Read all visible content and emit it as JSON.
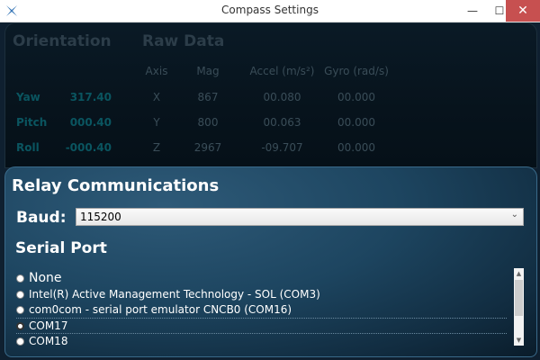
{
  "window": {
    "title": "Compass Settings",
    "minimize_glyph": "—",
    "maximize_glyph": "☐",
    "close_glyph": "✕"
  },
  "readout": {
    "orientation_header": "Orientation",
    "raw_header": "Raw Data",
    "columns": [
      "Axis",
      "Mag",
      "Accel (m/s²)",
      "Gyro (rad/s)"
    ],
    "rows": [
      {
        "label": "Yaw",
        "value": "317.40",
        "axis": "X",
        "mag": "867",
        "accel": "00.080",
        "gyro": "00.000"
      },
      {
        "label": "Pitch",
        "value": "000.40",
        "axis": "Y",
        "mag": "800",
        "accel": "00.063",
        "gyro": "00.000"
      },
      {
        "label": "Roll",
        "value": "-000.40",
        "axis": "Z",
        "mag": "2967",
        "accel": "-09.707",
        "gyro": "00.000"
      }
    ]
  },
  "relay": {
    "title": "Relay Communications",
    "baud_label": "Baud:",
    "baud_value": "115200",
    "serial_title": "Serial Port",
    "ports": [
      {
        "label": "None",
        "selected": false
      },
      {
        "label": "Intel(R) Active Management Technology - SOL (COM3)",
        "selected": false
      },
      {
        "label": "com0com - serial port emulator CNCB0 (COM16)",
        "selected": false
      },
      {
        "label": "COM17",
        "selected": true
      },
      {
        "label": "COM18",
        "selected": false
      }
    ]
  },
  "colors": {
    "accent_value": "#0a5560",
    "close_button": "#c75050",
    "panel_border": "#3a6a8a"
  },
  "icons": {
    "app": "compass-app-icon",
    "dropdown": "chevron-down-icon"
  }
}
